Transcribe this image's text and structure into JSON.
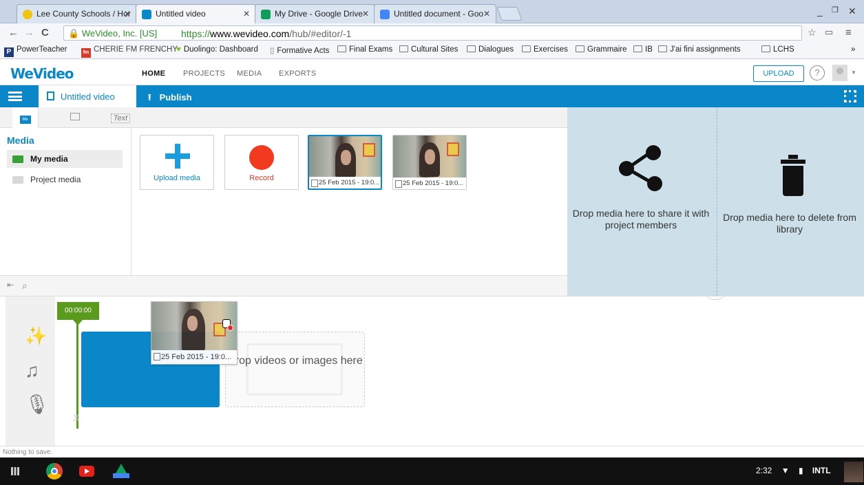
{
  "browser": {
    "tabs": [
      {
        "title": "Lee County Schools / Hor",
        "fav_color": "#f1c40f",
        "active": false
      },
      {
        "title": "Untitled video",
        "fav_color": "#0a87c9",
        "active": true
      },
      {
        "title": "My Drive - Google Drive",
        "fav_color": "#0f9d58",
        "active": false
      },
      {
        "title": "Untitled document - Goo",
        "fav_color": "#4285f4",
        "active": false
      }
    ],
    "secure_label": "WeVideo, Inc. [US]",
    "url_scheme": "https://",
    "url_host": "www.wevideo.com",
    "url_path": "/hub/#editor/-1",
    "bookmarks": [
      "PowerTeacher",
      "CHERIE FM FRENCHY",
      "Duolingo: Dashboard",
      "Formative Acts",
      "Final Exams",
      "Cultural Sites",
      "Dialogues",
      "Exercises",
      "Grammaire",
      "IB",
      "J'ai fini assignments",
      "LCHS"
    ]
  },
  "app": {
    "logo": "WeVideo",
    "nav": [
      "HOME",
      "PROJECTS",
      "MEDIA",
      "EXPORTS"
    ],
    "upload_label": "UPLOAD",
    "help_label": "?",
    "project_title": "Untitled video",
    "publish_label": "Publish",
    "accent": "#0a87c9"
  },
  "media": {
    "text_tab_label": "Text",
    "my_media_icon_label": "Me",
    "heading": "Media",
    "folders": [
      "My media",
      "Project media"
    ],
    "upload_label": "Upload media",
    "record_label": "Record",
    "clips": [
      "25 Feb 2015 - 19:0...",
      "25 Feb 2015 - 19:0..."
    ]
  },
  "dropzones": {
    "share_text": "Drop media here to share it with project members",
    "delete_text": "Drop media here to delete from library"
  },
  "timeline": {
    "timecode": "00:00:00",
    "drop_text": "Drop videos or images here",
    "drag_label": "25 Feb 2015 - 19:0...",
    "end_mark": "X"
  },
  "status": {
    "text": "Nothing to save."
  },
  "tray": {
    "time": "2:32",
    "input": "INTL"
  }
}
